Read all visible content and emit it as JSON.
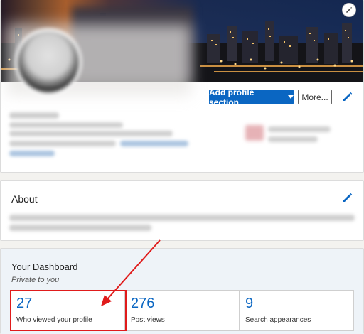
{
  "profile": {
    "add_section_label": "Add profile section",
    "more_label": "More...",
    "edit_cover_icon": "pencil-icon",
    "edit_intro_icon": "pencil-icon"
  },
  "about": {
    "title": "About",
    "edit_icon": "pencil-icon"
  },
  "dashboard": {
    "title": "Your Dashboard",
    "subtitle": "Private to you",
    "stats": [
      {
        "value": "27",
        "label": "Who viewed your profile"
      },
      {
        "value": "276",
        "label": "Post views"
      },
      {
        "value": "9",
        "label": "Search appearances"
      }
    ],
    "highlight_color": "#e01b1b"
  },
  "colors": {
    "accent": "#0a66c2",
    "annotation": "#e01b1b"
  }
}
